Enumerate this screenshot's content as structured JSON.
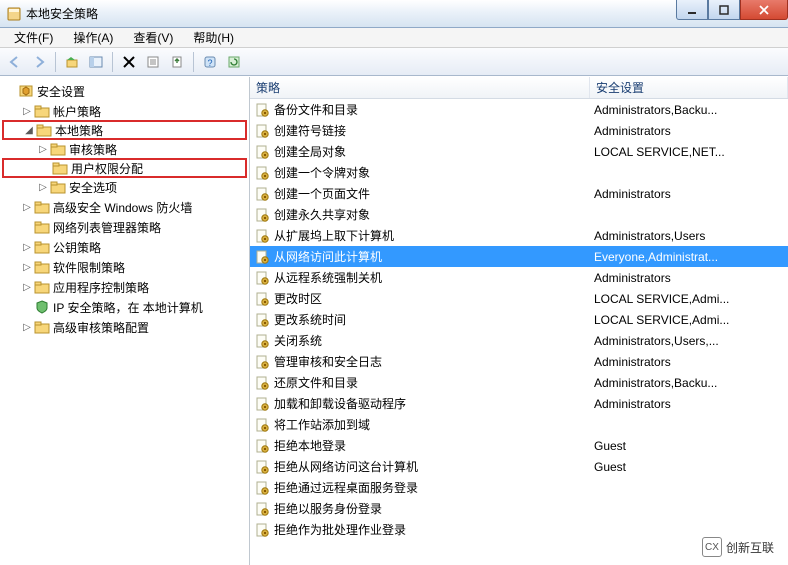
{
  "window": {
    "title": "本地安全策略"
  },
  "menu": {
    "file": "文件(F)",
    "action": "操作(A)",
    "view": "查看(V)",
    "help": "帮助(H)"
  },
  "tree": {
    "root": "安全设置",
    "items": [
      {
        "label": "帐户策略",
        "indent": 1,
        "expander": "▷",
        "highlight": false
      },
      {
        "label": "本地策略",
        "indent": 1,
        "expander": "◢",
        "highlight": true
      },
      {
        "label": "审核策略",
        "indent": 2,
        "expander": "▷",
        "highlight": false
      },
      {
        "label": "用户权限分配",
        "indent": 2,
        "expander": "",
        "highlight": true
      },
      {
        "label": "安全选项",
        "indent": 2,
        "expander": "▷",
        "highlight": false
      },
      {
        "label": "高级安全 Windows 防火墙",
        "indent": 1,
        "expander": "▷",
        "highlight": false
      },
      {
        "label": "网络列表管理器策略",
        "indent": 1,
        "expander": "",
        "highlight": false
      },
      {
        "label": "公钥策略",
        "indent": 1,
        "expander": "▷",
        "highlight": false
      },
      {
        "label": "软件限制策略",
        "indent": 1,
        "expander": "▷",
        "highlight": false
      },
      {
        "label": "应用程序控制策略",
        "indent": 1,
        "expander": "▷",
        "highlight": false
      },
      {
        "label": "IP 安全策略，在 本地计算机",
        "indent": 1,
        "expander": "",
        "highlight": false,
        "shield": true
      },
      {
        "label": "高级审核策略配置",
        "indent": 1,
        "expander": "▷",
        "highlight": false
      }
    ]
  },
  "list": {
    "headers": {
      "policy": "策略",
      "setting": "安全设置"
    },
    "rows": [
      {
        "policy": "备份文件和目录",
        "setting": "Administrators,Backu..."
      },
      {
        "policy": "创建符号链接",
        "setting": "Administrators"
      },
      {
        "policy": "创建全局对象",
        "setting": "LOCAL SERVICE,NET..."
      },
      {
        "policy": "创建一个令牌对象",
        "setting": ""
      },
      {
        "policy": "创建一个页面文件",
        "setting": "Administrators"
      },
      {
        "policy": "创建永久共享对象",
        "setting": ""
      },
      {
        "policy": "从扩展坞上取下计算机",
        "setting": "Administrators,Users"
      },
      {
        "policy": "从网络访问此计算机",
        "setting": "Everyone,Administrat...",
        "selected": true
      },
      {
        "policy": "从远程系统强制关机",
        "setting": "Administrators"
      },
      {
        "policy": "更改时区",
        "setting": "LOCAL SERVICE,Admi..."
      },
      {
        "policy": "更改系统时间",
        "setting": "LOCAL SERVICE,Admi..."
      },
      {
        "policy": "关闭系统",
        "setting": "Administrators,Users,..."
      },
      {
        "policy": "管理审核和安全日志",
        "setting": "Administrators"
      },
      {
        "policy": "还原文件和目录",
        "setting": "Administrators,Backu..."
      },
      {
        "policy": "加载和卸载设备驱动程序",
        "setting": "Administrators"
      },
      {
        "policy": "将工作站添加到域",
        "setting": ""
      },
      {
        "policy": "拒绝本地登录",
        "setting": "Guest"
      },
      {
        "policy": "拒绝从网络访问这台计算机",
        "setting": "Guest"
      },
      {
        "policy": "拒绝通过远程桌面服务登录",
        "setting": ""
      },
      {
        "policy": "拒绝以服务身份登录",
        "setting": ""
      },
      {
        "policy": "拒绝作为批处理作业登录",
        "setting": ""
      }
    ]
  },
  "watermark": {
    "text": "创新互联"
  }
}
